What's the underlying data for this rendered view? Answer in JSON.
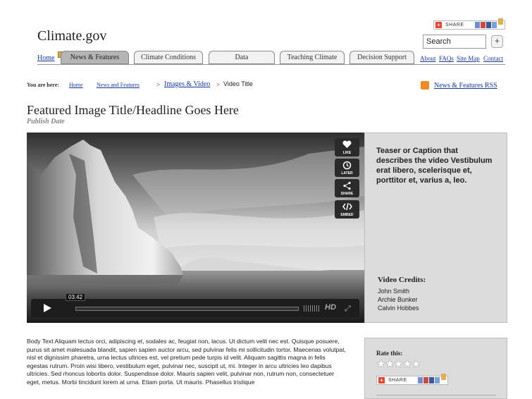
{
  "header": {
    "site_title": "Climate.gov",
    "share_label": "SHARE",
    "search_value": "Search",
    "search_button": "+"
  },
  "nav": {
    "home": "Home",
    "tabs": [
      "News & Features",
      "Climate Conditions",
      "Data",
      "Teaching Climate",
      "Decision Support"
    ],
    "active_tab": "News & Features",
    "utility_links": [
      "About",
      "FAQs",
      "Site Map",
      "Contact"
    ]
  },
  "breadcrumb": {
    "label": "You are here:",
    "items": [
      "Home",
      "News and Features",
      "Images & Video"
    ],
    "separator": ">",
    "current": "Video Title"
  },
  "rss": {
    "label": "News & Features RSS"
  },
  "article": {
    "headline": "Featured Image Title/Headline Goes Here",
    "publish_date": "Publish Date"
  },
  "video": {
    "actions": [
      {
        "label": "LIKE",
        "icon": "heart-icon"
      },
      {
        "label": "LATER",
        "icon": "clock-icon"
      },
      {
        "label": "SHARE",
        "icon": "share-icon"
      },
      {
        "label": "EMBED",
        "icon": "code-icon"
      }
    ],
    "time": "03:42",
    "hd_label": "HD",
    "progress": 0
  },
  "caption": {
    "teaser": "Teaser or Caption that describes the video Vestibulum erat libero, scelerisque et, porttitor et, varius a, leo.",
    "credits_heading": "Video Credits:",
    "credits": [
      "John Smith",
      "Archie Bunker",
      "Calvin Hobbes"
    ]
  },
  "body_text": "Body Text Aliquam lectus orci, adipiscing et, sodales ac, feugiat non, lacus. Ut dictum velit nec est. Quisque posuere, purus sit amet malesuada blandit, sapien sapien auctor arcu, sed pulvinar felis mi sollicitudin tortor. Maecenas volutpat, nisl et dignissim pharetra, urna lectus ultrices est, vel pretium pede turpis id velit. Aliquam sagittis magna in felis egestas rutrum. Proin wisi libero, vestibulum eget, pulvinar nec, suscipit ut, mi. Integer in arcu ultricies leo dapibus ultricies. Sed rhoncus lobortis dolor. Suspendisse dolor. Mauris sapien velit, pulvinar non, rutrum non, consectetuer eget, metus. Morbi tincidunt lorem at urna. Etiam porta. Ut mauris. Phasellus tristique",
  "rating": {
    "label": "Rate this:",
    "stars": "★★★★★",
    "value": 0,
    "max": 5,
    "share_label": "SHARE"
  },
  "colors": {
    "link": "#1a3a9a",
    "panel": "#dcdcdc",
    "active_tab": "#b5b5b5",
    "rss": "#f08a24"
  }
}
